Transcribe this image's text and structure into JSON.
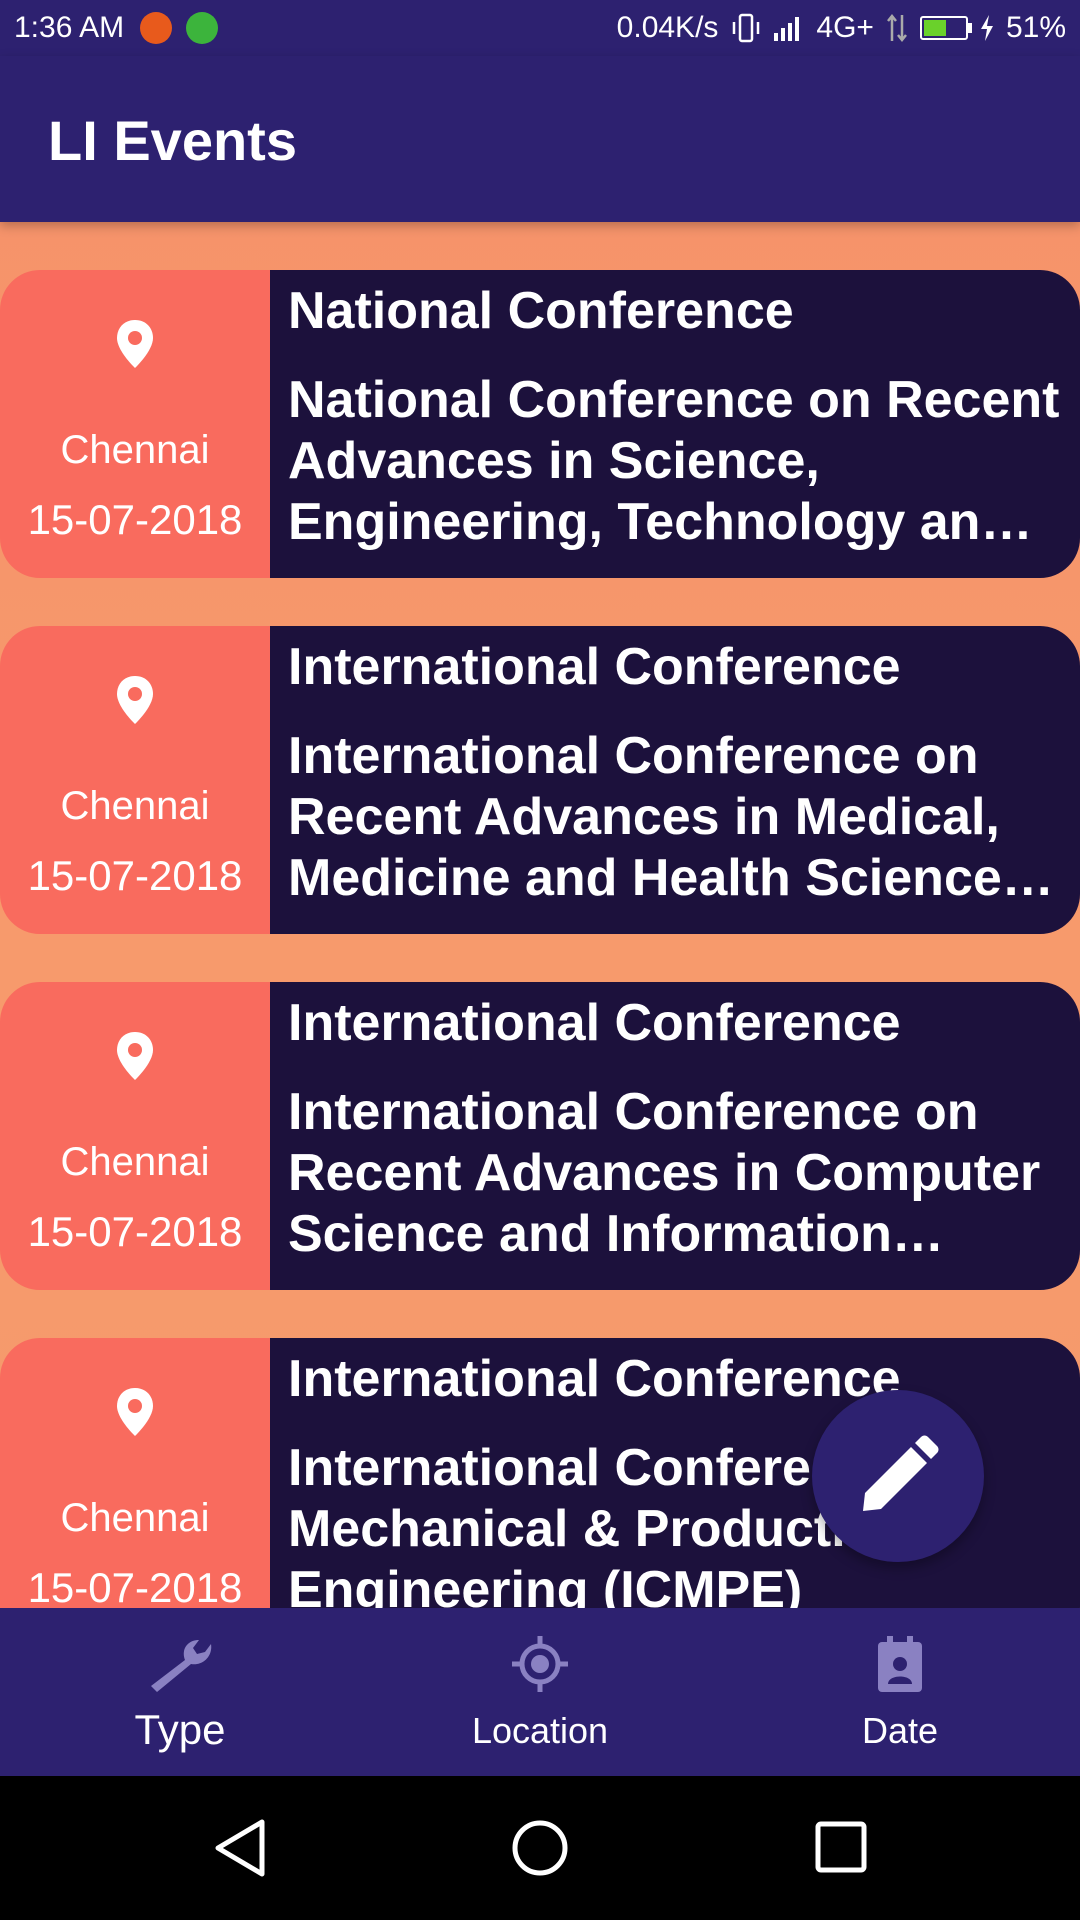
{
  "status_bar": {
    "time": "1:36 AM",
    "speed": "0.04K/s",
    "network": "4G+",
    "battery": "51%"
  },
  "app": {
    "title": "LI Events"
  },
  "events": [
    {
      "location": "Chennai",
      "date": "15-07-2018",
      "type": "National Conference",
      "title": "National Conference on Recent Advances in Science, Engineering, Technology and Management"
    },
    {
      "location": "Chennai",
      "date": "15-07-2018",
      "type": "International Conference",
      "title": "International Conference on Recent Advances in Medical, Medicine and Health Sciences (ICRAMMHS)"
    },
    {
      "location": "Chennai",
      "date": "15-07-2018",
      "type": "International Conference",
      "title": "International Conference on Recent Advances in Computer Science and Information Technology"
    },
    {
      "location": "Chennai",
      "date": "15-07-2018",
      "type": "International Conference",
      "title": "International Conference on Mechanical & Production Engineering (ICMPE)"
    }
  ],
  "fab": {
    "icon": "edit-pencil-icon"
  },
  "bottom_nav": {
    "items": [
      {
        "label": "Type",
        "icon": "wrench-icon"
      },
      {
        "label": "Location",
        "icon": "gps-target-icon"
      },
      {
        "label": "Date",
        "icon": "calendar-icon"
      }
    ]
  },
  "system_nav": {
    "icons": [
      "back-icon",
      "home-icon",
      "recents-icon"
    ]
  }
}
